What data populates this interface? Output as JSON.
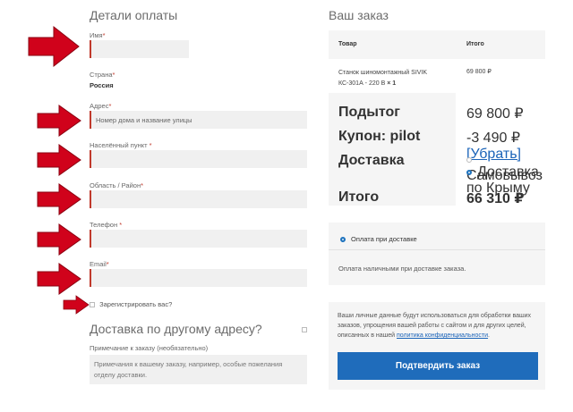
{
  "billing": {
    "title": "Детали оплаты",
    "name_label": "Имя",
    "country_label": "Страна",
    "country_value": "Россия",
    "address_label": "Адрес",
    "address_placeholder": "Номер дома и название улицы",
    "city_label": "Населённый пункт",
    "region_label": "Область / Район",
    "phone_label": "Телефон",
    "email_label": "Email",
    "required_mark": "*",
    "register_label": "Зарегистрировать вас?"
  },
  "shipping": {
    "title": "Доставка по другому адресу?",
    "note_label": "Примечание к заказу (необязательно)",
    "note_placeholder": "Примечания к вашему заказу, например, особые пожелания отделу доставки."
  },
  "order": {
    "title": "Ваш заказ",
    "col_product": "Товар",
    "col_total": "Итого",
    "product_name": "Станок шиномонтажный SIVIK КС-301А - 220 В",
    "product_qty": "× 1",
    "product_price": "69 800 ₽",
    "subtotal_label": "Подытог",
    "subtotal_value": "69 800 ₽",
    "coupon_label": "Купон: pilot",
    "coupon_value": "-3 490 ₽",
    "coupon_remove": "[Убрать]",
    "shipping_label": "Доставка",
    "shipping_opt1": "Самовывоз",
    "shipping_opt2": "Доставка по Крыму",
    "total_label": "Итого",
    "total_value": "66 310 ₽"
  },
  "payment": {
    "method_label": "Оплата при доставке",
    "method_desc": "Оплата наличными при доставке заказа."
  },
  "privacy": {
    "text": "Ваши личные данные будут использоваться для обработки ваших заказов, упрощения вашей работы с сайтом и для других целей, описанных в нашей",
    "link": "политика конфиденциальности",
    "end": "."
  },
  "submit_label": "Подтвердить заказ",
  "colors": {
    "arrow": "#d0021b",
    "button": "#1f6cbb",
    "required": "#c0392b"
  }
}
